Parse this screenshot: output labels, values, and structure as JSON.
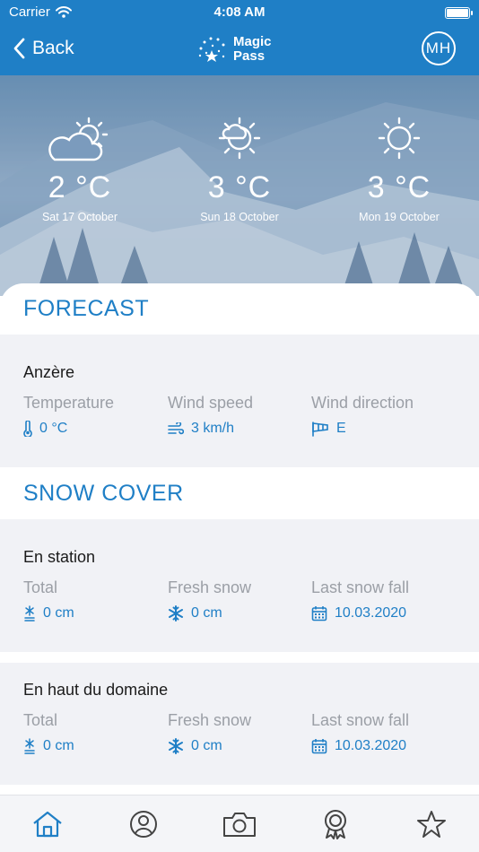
{
  "status": {
    "carrier": "Carrier",
    "time": "4:08 AM"
  },
  "nav": {
    "back_label": "Back",
    "logo_line1": "Magic",
    "logo_line2": "Pass",
    "avatar_initials": "MH"
  },
  "forecast_days": [
    {
      "icon": "partly-cloudy-icon",
      "temp": "2 °C",
      "date": "Sat 17 October"
    },
    {
      "icon": "sun-cloud-icon",
      "temp": "3 °C",
      "date": "Sun 18 October"
    },
    {
      "icon": "sun-icon",
      "temp": "3 °C",
      "date": "Mon 19 October"
    }
  ],
  "forecast": {
    "title": "FORECAST",
    "location": "Anzère",
    "temperature_label": "Temperature",
    "temperature_value": "0 °C",
    "wind_speed_label": "Wind speed",
    "wind_speed_value": "3 km/h",
    "wind_direction_label": "Wind direction",
    "wind_direction_value": "E"
  },
  "snow_cover": {
    "title": "SNOW COVER",
    "station": {
      "name": "En station",
      "total_label": "Total",
      "total_value": "0 cm",
      "fresh_label": "Fresh snow",
      "fresh_value": "0 cm",
      "last_label": "Last snow fall",
      "last_value": "10.03.2020"
    },
    "top": {
      "name": "En haut du domaine",
      "total_label": "Total",
      "total_value": "0 cm",
      "fresh_label": "Fresh snow",
      "fresh_value": "0 cm",
      "last_label": "Last snow fall",
      "last_value": "10.03.2020"
    }
  },
  "tabs": [
    "home-icon",
    "profile-icon",
    "camera-icon",
    "award-icon",
    "star-icon"
  ],
  "colors": {
    "brand": "#1f7fc6",
    "card_bg": "#f1f2f6",
    "label_gray": "#9b9fa6"
  }
}
